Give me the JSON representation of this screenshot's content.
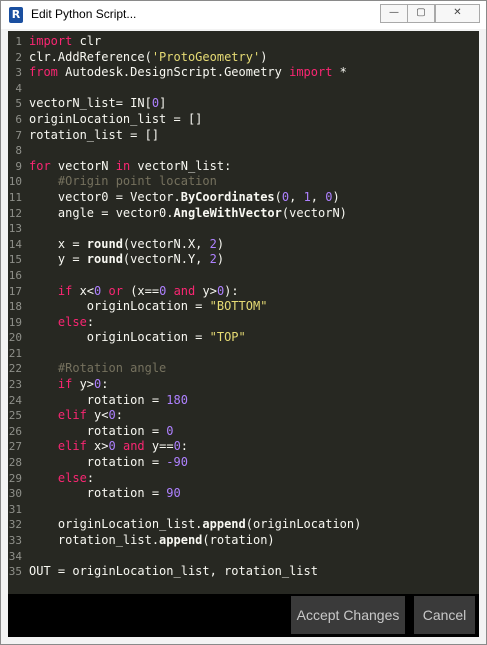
{
  "window": {
    "title": "Edit Python Script...",
    "app_icon_letter": "R",
    "minimize_symbol": "—",
    "maximize_symbol": "▢",
    "close_symbol": "✕"
  },
  "editor": {
    "lines": [
      {
        "n": "1",
        "html": "<span class=\"kw\">import</span> clr"
      },
      {
        "n": "2",
        "html": "clr.AddReference(<span class=\"str\">'ProtoGeometry'</span>)"
      },
      {
        "n": "3",
        "html": "<span class=\"kw\">from</span> Autodesk.DesignScript.Geometry <span class=\"kw\">import</span> *"
      },
      {
        "n": "4",
        "html": ""
      },
      {
        "n": "5",
        "html": "vectorN_list= IN[<span class=\"num\">0</span>]"
      },
      {
        "n": "6",
        "html": "originLocation_list = []"
      },
      {
        "n": "7",
        "html": "rotation_list = []"
      },
      {
        "n": "8",
        "html": ""
      },
      {
        "n": "9",
        "html": "<span class=\"kw\">for</span> vectorN <span class=\"kw\">in</span> vectorN_list:"
      },
      {
        "n": "10",
        "html": "    <span class=\"cmt\">#Origin point location</span>"
      },
      {
        "n": "11",
        "html": "    vector0 = Vector.<span class=\"fn\">ByCoordinates</span>(<span class=\"num\">0</span>, <span class=\"num\">1</span>, <span class=\"num\">0</span>)"
      },
      {
        "n": "12",
        "html": "    angle = vector0.<span class=\"fn\">AngleWithVector</span>(vectorN)"
      },
      {
        "n": "13",
        "html": ""
      },
      {
        "n": "14",
        "html": "    x = <span class=\"fn\">round</span>(vectorN.X, <span class=\"num\">2</span>)"
      },
      {
        "n": "15",
        "html": "    y = <span class=\"fn\">round</span>(vectorN.Y, <span class=\"num\">2</span>)"
      },
      {
        "n": "16",
        "html": ""
      },
      {
        "n": "17",
        "html": "    <span class=\"kw\">if</span> x&lt;<span class=\"num\">0</span> <span class=\"kw\">or</span> (x==<span class=\"num\">0</span> <span class=\"kw\">and</span> y&gt;<span class=\"num\">0</span>):"
      },
      {
        "n": "18",
        "html": "        originLocation = <span class=\"str\">\"BOTTOM\"</span>"
      },
      {
        "n": "19",
        "html": "    <span class=\"kw\">else</span>:"
      },
      {
        "n": "20",
        "html": "        originLocation = <span class=\"str\">\"TOP\"</span>"
      },
      {
        "n": "21",
        "html": ""
      },
      {
        "n": "22",
        "html": "    <span class=\"cmt\">#Rotation angle</span>"
      },
      {
        "n": "23",
        "html": "    <span class=\"kw\">if</span> y&gt;<span class=\"num\">0</span>:"
      },
      {
        "n": "24",
        "html": "        rotation = <span class=\"num\">180</span>"
      },
      {
        "n": "25",
        "html": "    <span class=\"kw\">elif</span> y&lt;<span class=\"num\">0</span>:"
      },
      {
        "n": "26",
        "html": "        rotation = <span class=\"num\">0</span>"
      },
      {
        "n": "27",
        "html": "    <span class=\"kw\">elif</span> x&gt;<span class=\"num\">0</span> <span class=\"kw\">and</span> y==<span class=\"num\">0</span>:"
      },
      {
        "n": "28",
        "html": "        rotation = <span class=\"num\">-90</span>"
      },
      {
        "n": "29",
        "html": "    <span class=\"kw\">else</span>:"
      },
      {
        "n": "30",
        "html": "        rotation = <span class=\"num\">90</span>"
      },
      {
        "n": "31",
        "html": ""
      },
      {
        "n": "32",
        "html": "    originLocation_list.<span class=\"fn\">append</span>(originLocation)"
      },
      {
        "n": "33",
        "html": "    rotation_list.<span class=\"fn\">append</span>(rotation)"
      },
      {
        "n": "34",
        "html": ""
      },
      {
        "n": "35",
        "html": "OUT = originLocation_list, rotation_list"
      }
    ]
  },
  "footer": {
    "accept_label": "Accept Changes",
    "cancel_label": "Cancel"
  }
}
